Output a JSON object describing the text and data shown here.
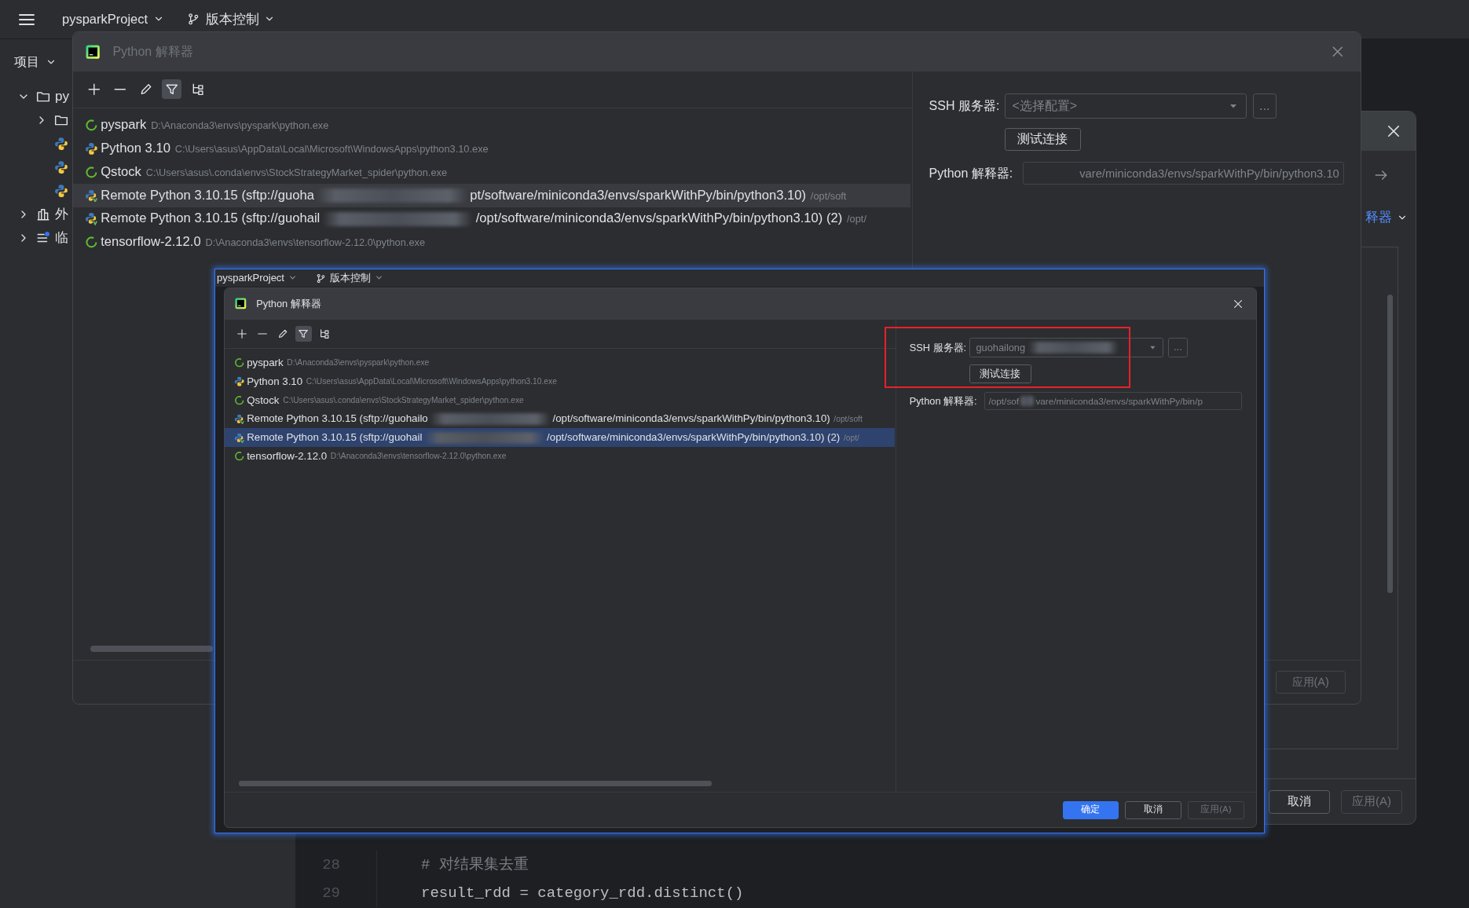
{
  "ide_top_bar": {
    "project": "pysparkProject",
    "vcs": "版本控制"
  },
  "project_panel": {
    "title": "项目",
    "tree": [
      {
        "kind": "folder",
        "label": "py",
        "expanded": true,
        "children": [
          {
            "kind": "folder",
            "expanded": false
          },
          {
            "kind": "python"
          },
          {
            "kind": "python"
          },
          {
            "kind": "python"
          }
        ]
      },
      {
        "kind": "library",
        "label": "外",
        "expanded": false
      },
      {
        "kind": "scratch",
        "label": "临",
        "expanded": false
      }
    ]
  },
  "editor": {
    "lines": [
      {
        "number": "28",
        "kind": "comment",
        "code": "# 对结果集去重"
      },
      {
        "number": "29",
        "kind": "code",
        "code": "result_rdd = category_rdd.distinct()"
      }
    ]
  },
  "back_dialog": {
    "link": "释器",
    "buttons": [
      {
        "label": "取消",
        "kind": "secondary",
        "disabled": false
      },
      {
        "label": "应用(A)",
        "kind": "secondary",
        "disabled": true
      }
    ]
  },
  "dialog": {
    "title": "Python 解释器",
    "active": false,
    "toolbar": [
      {
        "kind": "add"
      },
      {
        "kind": "remove"
      },
      {
        "kind": "edit"
      },
      {
        "kind": "filter",
        "on": true
      },
      {
        "kind": "tree"
      }
    ],
    "interpreters": [
      {
        "kind": "conda",
        "name": "pyspark",
        "path": "D:\\Anaconda3\\envs\\pyspark\\python.exe",
        "selected": false
      },
      {
        "kind": "python",
        "name": "Python 3.10",
        "path": "C:\\Users\\asus\\AppData\\Local\\Microsoft\\WindowsApps\\python3.10.exe",
        "selected": false
      },
      {
        "kind": "conda",
        "name": "Qstock",
        "path": "C:\\Users\\asus\\.conda\\envs\\StockStrategyMarket_spider\\python.exe",
        "selected": false
      },
      {
        "kind": "remote",
        "name": "Remote Python 3.10.15 (sftp://guoha",
        "redacted": true,
        "name_end": "pt/software/miniconda3/envs/sparkWithPy/bin/python3.10)",
        "path": "/opt/soft",
        "selected": true
      },
      {
        "kind": "remote",
        "name": "Remote Python 3.10.15 (sftp://guohail",
        "redacted": true,
        "name_end": "/opt/software/miniconda3/envs/sparkWithPy/bin/python3.10) (2)",
        "path": "/opt/",
        "selected": false
      },
      {
        "kind": "conda",
        "name": "tensorflow-2.12.0",
        "path": "D:\\Anaconda3\\envs\\tensorflow-2.12.0\\python.exe",
        "selected": false
      }
    ],
    "ssh_label": "SSH 服务器:",
    "ssh_server": {
      "placeholder": "<选择配置>"
    },
    "more_button": "...",
    "test_button": "测试连接",
    "interpreter_label": "Python 解释器:",
    "interpreter_path": {
      "value": "vare/miniconda3/envs/sparkWithPy/bin/python3.10"
    },
    "buttons": [
      {
        "label": "应用(A)",
        "kind": "secondary",
        "disabled": true
      }
    ]
  },
  "inset_screenshot": {
    "top_bar": {
      "project": "pysparkProject",
      "vcs": "版本控制"
    },
    "dialog": {
      "title": "Python 解释器",
      "active": true,
      "toolbar": [
        {
          "kind": "add"
        },
        {
          "kind": "remove"
        },
        {
          "kind": "edit"
        },
        {
          "kind": "filter",
          "on": true
        },
        {
          "kind": "tree"
        }
      ],
      "interpreters": [
        {
          "kind": "conda",
          "name": "pyspark",
          "path": "D:\\Anaconda3\\envs\\pyspark\\python.exe",
          "selected": false
        },
        {
          "kind": "python",
          "name": "Python 3.10",
          "path": "C:\\Users\\asus\\AppData\\Local\\Microsoft\\WindowsApps\\python3.10.exe",
          "selected": false
        },
        {
          "kind": "conda",
          "name": "Qstock",
          "path": "C:\\Users\\asus\\.conda\\envs\\StockStrategyMarket_spider\\python.exe",
          "selected": false
        },
        {
          "kind": "remote",
          "name": "Remote Python 3.10.15 (sftp://guohailo",
          "redacted": true,
          "name_end": "/opt/software/miniconda3/envs/sparkWithPy/bin/python3.10)",
          "path": "/opt/soft",
          "selected": false
        },
        {
          "kind": "remote",
          "name": "Remote Python 3.10.15 (sftp://guohail",
          "redacted": true,
          "name_end": "/opt/software/miniconda3/envs/sparkWithPy/bin/python3.10) (2)",
          "path": "/opt/",
          "selected": true
        },
        {
          "kind": "conda",
          "name": "tensorflow-2.12.0",
          "path": "D:\\Anaconda3\\envs\\tensorflow-2.12.0\\python.exe",
          "selected": false
        }
      ],
      "ssh_label": "SSH 服务器:",
      "ssh_server": {
        "value": "guohailong",
        "redacted": true
      },
      "more_button": "...",
      "test_button": "测试连接",
      "highlighted": true,
      "interpreter_label": "Python 解释器:",
      "interpreter_path": {
        "value": "/opt/sof",
        "redacted": true,
        "value_end": "vare/miniconda3/envs/sparkWithPy/bin/p"
      },
      "buttons": [
        {
          "label": "确定",
          "kind": "primary",
          "disabled": false
        },
        {
          "label": "取消",
          "kind": "secondary",
          "disabled": false
        },
        {
          "label": "应用(A)",
          "kind": "secondary",
          "disabled": true
        }
      ]
    }
  }
}
